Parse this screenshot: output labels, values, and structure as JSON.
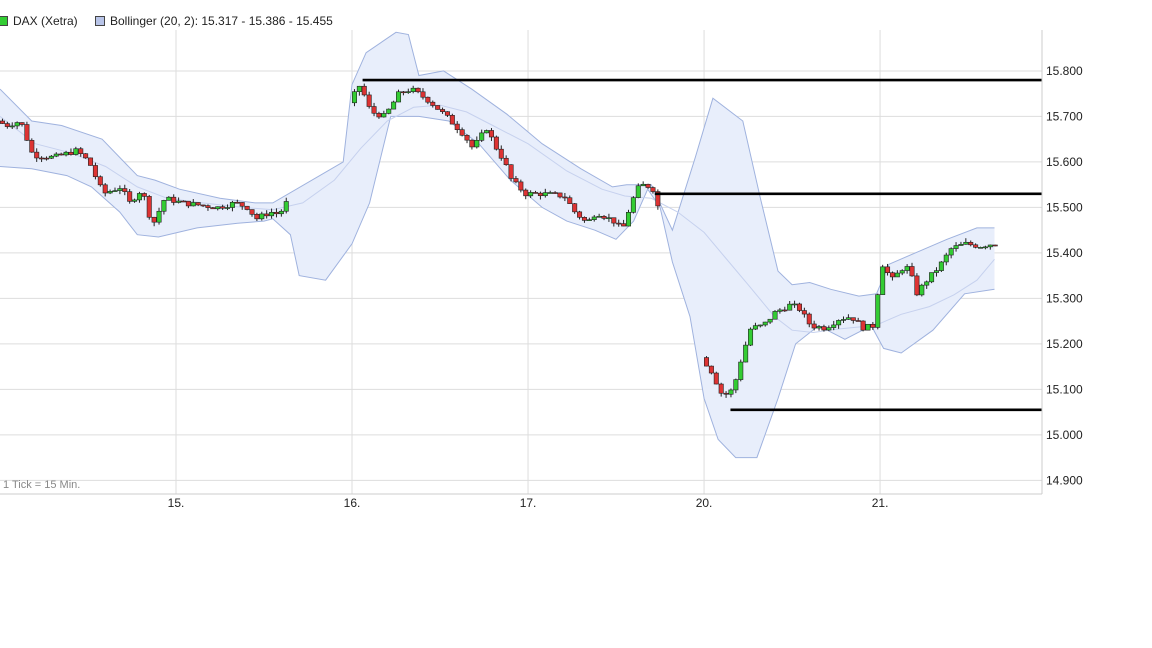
{
  "legend": {
    "dax_label": "DAX (Xetra)",
    "bollinger_label": "Bollinger (20, 2): 15.317 - 15.386 - 15.455",
    "dax_color": "#33cc33",
    "bollinger_color": "#b8c4e8"
  },
  "tick_note": "1 Tick = 15 Min.",
  "chart_data": {
    "type": "candlestick",
    "interval": "15 Min.",
    "y_ticks": [
      "15.800",
      "15.700",
      "15.600",
      "15.500",
      "15.400",
      "15.300",
      "15.200",
      "15.100",
      "15.000",
      "14.900"
    ],
    "y_tick_values": [
      15800,
      15700,
      15600,
      15500,
      15400,
      15300,
      15200,
      15100,
      15000,
      14900
    ],
    "x_ticks": [
      "15.",
      "16.",
      "17.",
      "20.",
      "21."
    ],
    "x_tick_positions": [
      3.5,
      4.5,
      5.5,
      6.5,
      7.5
    ],
    "x_range": [
      2.5,
      8.42
    ],
    "y_range": [
      14870,
      15890
    ],
    "grid": true,
    "colors": {
      "up": "#33cc33",
      "down": "#dd3333",
      "band_fill": "#e8eefb",
      "band_line": "#9fb2de",
      "level_line": "#000000"
    },
    "price_anchors": [
      [
        2.5,
        15690
      ],
      [
        2.55,
        15680
      ],
      [
        2.63,
        15690
      ],
      [
        2.7,
        15615
      ],
      [
        2.82,
        15610
      ],
      [
        2.95,
        15625
      ],
      [
        3.02,
        15600
      ],
      [
        3.1,
        15530
      ],
      [
        3.2,
        15545
      ],
      [
        3.25,
        15510
      ],
      [
        3.32,
        15540
      ],
      [
        3.38,
        15460
      ],
      [
        3.45,
        15520
      ],
      [
        3.55,
        15510
      ],
      [
        3.65,
        15505
      ],
      [
        3.75,
        15500
      ],
      [
        3.85,
        15510
      ],
      [
        3.92,
        15500
      ],
      [
        3.97,
        15475
      ],
      [
        4.05,
        15490
      ],
      [
        4.1,
        15485
      ],
      [
        4.5,
        15730
      ],
      [
        4.56,
        15770
      ],
      [
        4.62,
        15710
      ],
      [
        4.7,
        15700
      ],
      [
        4.78,
        15750
      ],
      [
        4.85,
        15760
      ],
      [
        4.95,
        15735
      ],
      [
        5.05,
        15700
      ],
      [
        5.15,
        15660
      ],
      [
        5.2,
        15630
      ],
      [
        5.28,
        15675
      ],
      [
        5.32,
        15640
      ],
      [
        5.38,
        15600
      ],
      [
        5.42,
        15560
      ],
      [
        5.5,
        15530
      ],
      [
        5.6,
        15530
      ],
      [
        5.72,
        15525
      ],
      [
        5.78,
        15490
      ],
      [
        5.85,
        15465
      ],
      [
        5.9,
        15490
      ],
      [
        6.0,
        15470
      ],
      [
        6.05,
        15450
      ],
      [
        6.1,
        15510
      ],
      [
        6.15,
        15550
      ],
      [
        6.22,
        15545
      ],
      [
        6.5,
        15170
      ],
      [
        6.55,
        15145
      ],
      [
        6.62,
        15085
      ],
      [
        6.68,
        15100
      ],
      [
        6.72,
        15160
      ],
      [
        6.78,
        15235
      ],
      [
        6.85,
        15240
      ],
      [
        6.92,
        15270
      ],
      [
        7.0,
        15285
      ],
      [
        7.05,
        15280
      ],
      [
        7.12,
        15240
      ],
      [
        7.2,
        15235
      ],
      [
        7.28,
        15255
      ],
      [
        7.35,
        15260
      ],
      [
        7.42,
        15235
      ],
      [
        7.48,
        15240
      ],
      [
        7.52,
        15380
      ],
      [
        7.58,
        15340
      ],
      [
        7.65,
        15370
      ],
      [
        7.68,
        15365
      ],
      [
        7.72,
        15310
      ],
      [
        7.78,
        15340
      ],
      [
        7.85,
        15370
      ],
      [
        7.92,
        15410
      ],
      [
        8.0,
        15420
      ],
      [
        8.08,
        15415
      ],
      [
        8.15,
        15420
      ]
    ],
    "bollinger": {
      "upper": [
        [
          2.5,
          15760
        ],
        [
          2.68,
          15690
        ],
        [
          2.85,
          15680
        ],
        [
          3.08,
          15650
        ],
        [
          3.28,
          15570
        ],
        [
          3.38,
          15560
        ],
        [
          3.52,
          15540
        ],
        [
          3.75,
          15520
        ],
        [
          3.95,
          15510
        ],
        [
          4.05,
          15510
        ],
        [
          4.45,
          15600
        ],
        [
          4.5,
          15770
        ],
        [
          4.58,
          15840
        ],
        [
          4.75,
          15885
        ],
        [
          4.82,
          15880
        ],
        [
          4.88,
          15790
        ],
        [
          5.02,
          15800
        ],
        [
          5.18,
          15760
        ],
        [
          5.38,
          15705
        ],
        [
          5.58,
          15640
        ],
        [
          5.8,
          15585
        ],
        [
          5.98,
          15545
        ],
        [
          6.06,
          15550
        ],
        [
          6.2,
          15550
        ],
        [
          6.32,
          15450
        ],
        [
          6.45,
          15610
        ],
        [
          6.55,
          15740
        ],
        [
          6.72,
          15690
        ],
        [
          6.82,
          15520
        ],
        [
          6.92,
          15360
        ],
        [
          7.0,
          15330
        ],
        [
          7.1,
          15335
        ],
        [
          7.22,
          15320
        ],
        [
          7.38,
          15305
        ],
        [
          7.48,
          15310
        ],
        [
          7.55,
          15375
        ],
        [
          7.7,
          15400
        ],
        [
          7.88,
          15430
        ],
        [
          8.05,
          15455
        ],
        [
          8.15,
          15455
        ]
      ],
      "mid": [
        [
          2.5,
          15700
        ],
        [
          2.7,
          15640
        ],
        [
          2.9,
          15620
        ],
        [
          3.1,
          15590
        ],
        [
          3.28,
          15545
        ],
        [
          3.45,
          15520
        ],
        [
          3.65,
          15510
        ],
        [
          3.88,
          15500
        ],
        [
          4.05,
          15495
        ],
        [
          4.22,
          15510
        ],
        [
          4.4,
          15560
        ],
        [
          4.55,
          15630
        ],
        [
          4.7,
          15690
        ],
        [
          4.85,
          15720
        ],
        [
          5.0,
          15725
        ],
        [
          5.15,
          15710
        ],
        [
          5.3,
          15680
        ],
        [
          5.5,
          15640
        ],
        [
          5.72,
          15580
        ],
        [
          5.92,
          15540
        ],
        [
          6.05,
          15525
        ],
        [
          6.2,
          15520
        ],
        [
          6.35,
          15490
        ],
        [
          6.5,
          15445
        ],
        [
          6.62,
          15390
        ],
        [
          6.75,
          15330
        ],
        [
          6.9,
          15260
        ],
        [
          7.0,
          15230
        ],
        [
          7.12,
          15225
        ],
        [
          7.25,
          15232
        ],
        [
          7.4,
          15238
        ],
        [
          7.5,
          15245
        ],
        [
          7.62,
          15265
        ],
        [
          7.78,
          15282
        ],
        [
          7.92,
          15308
        ],
        [
          8.05,
          15340
        ],
        [
          8.15,
          15386
        ]
      ],
      "lower": [
        [
          2.5,
          15590
        ],
        [
          2.68,
          15585
        ],
        [
          2.88,
          15570
        ],
        [
          3.02,
          15545
        ],
        [
          3.18,
          15490
        ],
        [
          3.28,
          15440
        ],
        [
          3.4,
          15435
        ],
        [
          3.62,
          15455
        ],
        [
          3.85,
          15465
        ],
        [
          4.0,
          15470
        ],
        [
          4.05,
          15475
        ],
        [
          4.15,
          15440
        ],
        [
          4.2,
          15350
        ],
        [
          4.35,
          15340
        ],
        [
          4.5,
          15420
        ],
        [
          4.6,
          15510
        ],
        [
          4.72,
          15700
        ],
        [
          4.88,
          15700
        ],
        [
          5.05,
          15690
        ],
        [
          5.22,
          15640
        ],
        [
          5.4,
          15560
        ],
        [
          5.58,
          15500
        ],
        [
          5.72,
          15470
        ],
        [
          5.88,
          15450
        ],
        [
          6.0,
          15430
        ],
        [
          6.1,
          15470
        ],
        [
          6.18,
          15540
        ],
        [
          6.25,
          15500
        ],
        [
          6.32,
          15380
        ],
        [
          6.42,
          15260
        ],
        [
          6.5,
          15080
        ],
        [
          6.58,
          14990
        ],
        [
          6.68,
          14950
        ],
        [
          6.8,
          14950
        ],
        [
          6.92,
          15080
        ],
        [
          7.02,
          15200
        ],
        [
          7.15,
          15240
        ],
        [
          7.3,
          15210
        ],
        [
          7.45,
          15240
        ],
        [
          7.52,
          15190
        ],
        [
          7.62,
          15180
        ],
        [
          7.8,
          15230
        ],
        [
          7.98,
          15310
        ],
        [
          8.15,
          15320
        ]
      ]
    },
    "levels": [
      {
        "value": 15780,
        "x_from": 4.56,
        "x_to": 8.42
      },
      {
        "value": 15530,
        "x_from": 6.22,
        "x_to": 8.42
      },
      {
        "value": 15055,
        "x_from": 6.65,
        "x_to": 8.42
      }
    ]
  }
}
